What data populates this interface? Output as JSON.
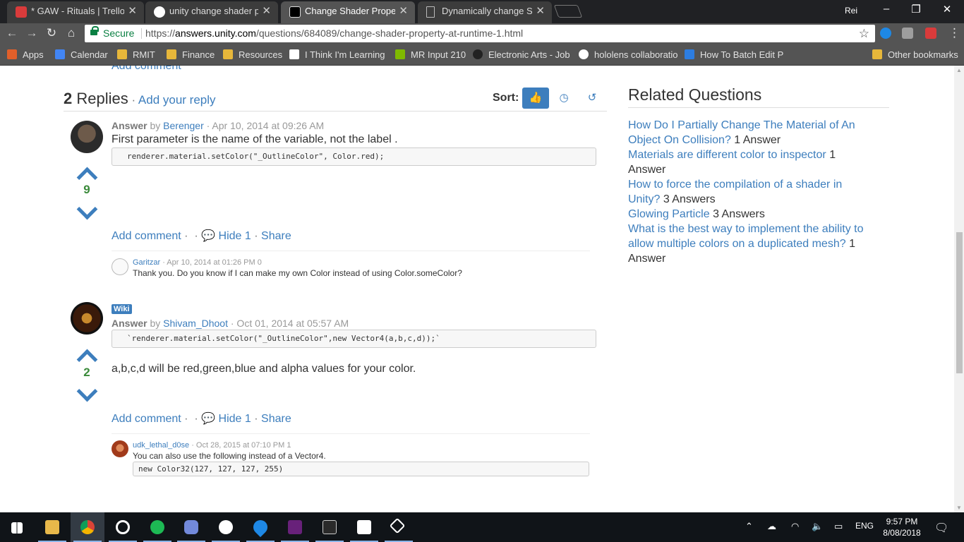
{
  "browser": {
    "tabs": [
      {
        "title": "* GAW - Rituals | Trello",
        "active": false
      },
      {
        "title": "unity change shader prop",
        "active": false
      },
      {
        "title": "Change Shader Property",
        "active": true
      },
      {
        "title": "Dynamically change Shad",
        "active": false
      }
    ],
    "profile": "Rei",
    "secure_label": "Secure",
    "url_scheme": "https://",
    "url_host": "answers.unity.com",
    "url_path": "/questions/684089/change-shader-property-at-runtime-1.html",
    "bookmarks": [
      {
        "label": "Apps"
      },
      {
        "label": "Calendar"
      },
      {
        "label": "RMIT"
      },
      {
        "label": "Finance"
      },
      {
        "label": "Resources"
      },
      {
        "label": "I Think I'm Learning"
      },
      {
        "label": "MR Input 210"
      },
      {
        "label": "Electronic Arts - Job"
      },
      {
        "label": "hololens collaboratio"
      },
      {
        "label": "How To Batch Edit P"
      },
      {
        "label": "Other bookmarks"
      }
    ]
  },
  "page": {
    "top_link": "Add comment",
    "replies_count": "2",
    "replies_label": "Replies",
    "add_reply": "Add your reply",
    "sort_label": "Sort:",
    "answers": [
      {
        "votes": "9",
        "label": "Answer",
        "by": "by",
        "author": "Berenger",
        "date": "· Apr 10, 2014 at 09:26 AM",
        "text": "First parameter is the name of the variable, not the label .",
        "code": "renderer.material.setColor(\"_OutlineColor\", Color.red);",
        "add_comment": "Add comment",
        "hide": "Hide 1",
        "share": "Share",
        "comment": {
          "author": "Garitzar",
          "meta": "· Apr 10, 2014 at 01:26 PM 0",
          "text": "Thank you. Do you know if I can make my own Color instead of using Color.someColor?"
        }
      },
      {
        "badge": "Wiki",
        "votes": "2",
        "label": "Answer",
        "by": "by",
        "author": "Shivam_Dhoot",
        "date": "· Oct 01, 2014 at 05:57 AM",
        "code": "`renderer.material.setColor(\"_OutlineColor\",new Vector4(a,b,c,d));`",
        "text": "a,b,c,d will be red,green,blue and alpha values for your color.",
        "add_comment": "Add comment",
        "hide": "Hide 1",
        "share": "Share",
        "comment": {
          "author": "udk_lethal_d0se",
          "meta": "· Oct 28, 2015 at 07:10 PM 1",
          "text": "You can also use the following instead of a Vector4.",
          "code": "new Color32(127, 127, 127, 255)"
        }
      }
    ],
    "related": {
      "title": "Related Questions",
      "items": [
        {
          "link_a": "How Do I Partially Change The Material of An",
          "link_b": "Object On Collision?",
          "count": "1 Answer"
        },
        {
          "link_a": "Materials are different color to inspector",
          "count_a": "1",
          "count_b": "Answer"
        },
        {
          "link_a": "How to force the compilation of a shader in",
          "link_b": "Unity?",
          "count": "3 Answers"
        },
        {
          "link_a": "Glowing Particle",
          "count": "3 Answers"
        },
        {
          "link_a": "What is the best way to implement the ability to",
          "link_b": "allow multiple colors on a duplicated mesh?",
          "count_a": "1",
          "count_b": "Answer"
        }
      ]
    }
  },
  "taskbar": {
    "language": "ENG",
    "time": "9:57 PM",
    "date": "8/08/2018"
  },
  "colors": {
    "link": "#3d7ebd",
    "vote_count": "#3a8a3a",
    "secure": "#0b8043",
    "chrome_dark": "#202124",
    "toolbar": "#545454"
  }
}
